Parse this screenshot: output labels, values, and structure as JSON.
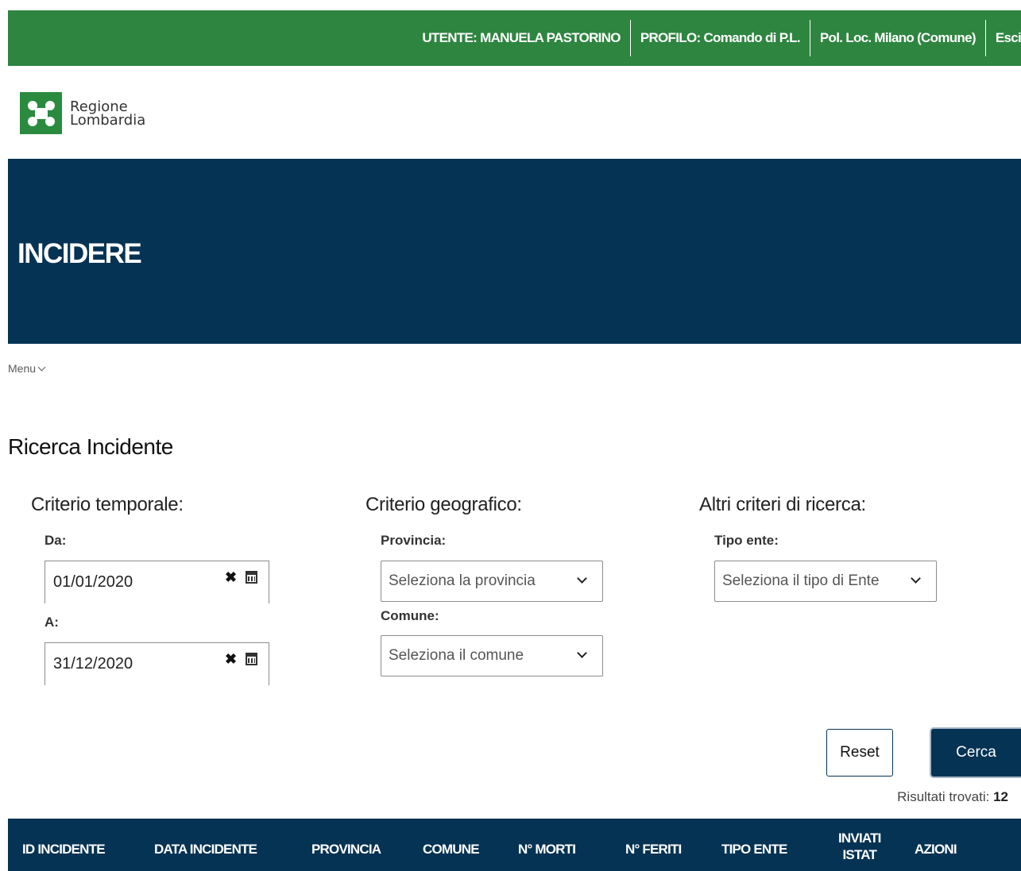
{
  "topbar": {
    "user": "UTENTE: MANUELA PASTORINO",
    "profile": "PROFILO: Comando di P.L.",
    "entity": "Pol. Loc. Milano (Comune)",
    "logout": "Esci"
  },
  "brand": {
    "line1": "Regione",
    "line2": "Lombardia",
    "color": "#2a8b3f"
  },
  "app_title": "INCIDERE",
  "menu_label": "Menu",
  "page_title": "Ricerca Incidente",
  "temporal": {
    "title": "Criterio temporale:",
    "from_label": "Da:",
    "from_value": "01/01/2020",
    "to_label": "A:",
    "to_value": "31/12/2020",
    "clear_glyph": "✖"
  },
  "geographic": {
    "title": "Criterio geografico:",
    "province_label": "Provincia:",
    "province_placeholder": "Seleziona la provincia",
    "comune_label": "Comune:",
    "comune_placeholder": "Seleziona il comune"
  },
  "other": {
    "title": "Altri criteri di ricerca:",
    "ente_label": "Tipo ente:",
    "ente_placeholder": "Seleziona il tipo di Ente"
  },
  "buttons": {
    "reset": "Reset",
    "search": "Cerca"
  },
  "results": {
    "label": "Risultati trovati:",
    "count": "12"
  },
  "table": {
    "columns": [
      "ID INCIDENTE",
      "DATA INCIDENTE",
      "PROVINCIA",
      "COMUNE",
      "N° MORTI",
      "N° FERITI",
      "TIPO ENTE",
      "INVIATI",
      "ISTAT",
      "AZIONI"
    ]
  },
  "colors": {
    "topbar": "#2e8540",
    "primary": "#053354"
  }
}
